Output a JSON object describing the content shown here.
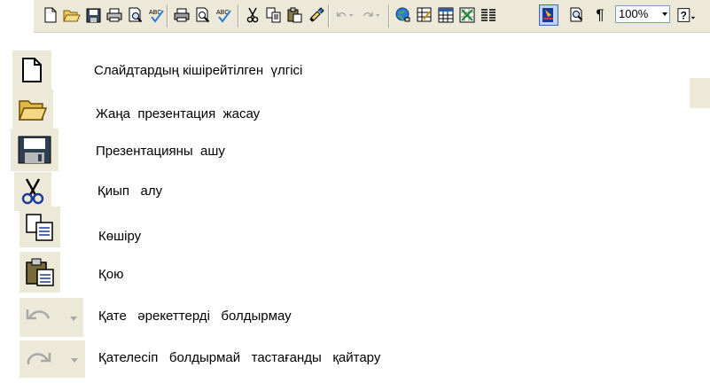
{
  "toolbar": {
    "icons": [
      "new-icon",
      "open-icon",
      "save-icon",
      "print-icon",
      "print-preview-icon",
      "spelling-icon",
      "print2-icon",
      "preview-icon",
      "spelling2-icon",
      "cut-icon",
      "copy-icon",
      "paste-icon",
      "format-painter-icon",
      "undo-icon",
      "redo-icon",
      "hyperlink-icon",
      "tables-borders-icon",
      "insert-table-icon",
      "insert-chart-icon",
      "columns-icon",
      "color-icon",
      "zoom-view-icon",
      "show-formatting-icon",
      "help-icon"
    ],
    "zoom_value": "100%"
  },
  "legend": {
    "items": [
      {
        "icon": "new-slide-icon",
        "label": "Слайдтардың кішірейтілген  үлгісі"
      },
      {
        "icon": "open-folder-icon",
        "label": "Жаңа  презентация  жасау"
      },
      {
        "icon": "save-disk-icon",
        "label": "Презентацияны  ашу"
      },
      {
        "icon": "scissors-icon",
        "label": "Қиып   алу"
      },
      {
        "icon": "copy-icon",
        "label": "Көшіру"
      },
      {
        "icon": "paste-icon",
        "label": "Қою"
      },
      {
        "icon": "undo-icon",
        "label": "Қате   әрекеттерді   болдырмау"
      },
      {
        "icon": "redo-icon",
        "label": "Қателесіп   болдырмай   тастағанды   қайтару"
      }
    ]
  },
  "colors": {
    "toolbar_bg": "#ece9d8",
    "accent": "#316ac5"
  }
}
